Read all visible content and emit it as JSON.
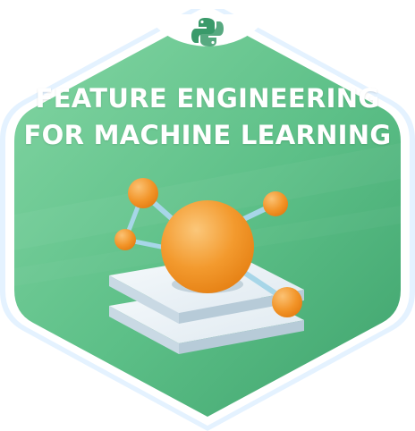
{
  "badge": {
    "title_line_1": "FEATURE ENGINEERING",
    "title_line_2": "FOR MACHINE LEARNING",
    "top_icon": "python-logo-icon",
    "illustration": "feature-graph-illustration"
  },
  "colors": {
    "badge_green": "#5cbf87",
    "badge_green_light": "#7fd3a0",
    "badge_green_dark": "#3fa76f",
    "outer_ring": "#dff0ff",
    "logo_green": "#3a9a6a",
    "node_orange": "#f39a2e",
    "node_orange_light": "#f7b865",
    "layer_white": "#eef4f8",
    "connector_blue": "#9fd0e4"
  }
}
